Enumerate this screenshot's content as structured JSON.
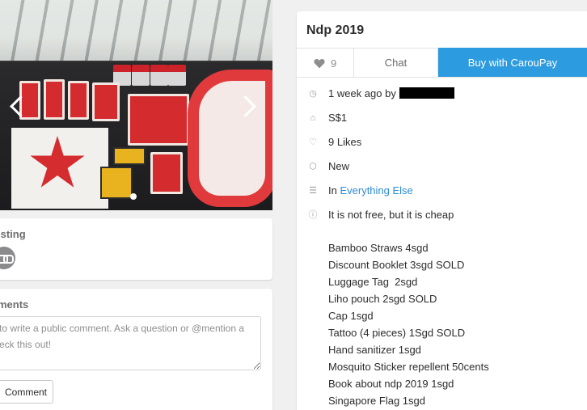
{
  "listing": {
    "title": "Ndp 2019",
    "likes_count": "9",
    "chat_label": "Chat",
    "buy_label": "Buy with CarouPay",
    "posted": "1 week ago by",
    "price": "S$1",
    "likes_text": "9 Likes",
    "condition": "New",
    "category_prefix": "In",
    "category": "Everything Else",
    "tagline": "It is not free, but it is cheap",
    "items": [
      "Bamboo Straws 4sgd",
      "Discount Booklet 3sgd SOLD",
      "Luggage Tag  2sgd",
      "Liho pouch 2sgd SOLD",
      "Cap 1sgd",
      "Tattoo (4 pieces) 1Sgd SOLD",
      "Hand sanitizer 1sgd",
      "Mosquito Sticker repellent 50cents",
      "Book about ndp 2019 1sgd",
      "Singapore Flag 1sgd"
    ]
  },
  "share": {
    "heading": "isting"
  },
  "comments": {
    "heading": "ments",
    "placeholder": "to write a public comment. Ask a question or @mention a\neck this out!",
    "button_label": "Comment"
  },
  "icons": {
    "time": "clock-icon",
    "price": "price-tag-icon",
    "likes": "heart-outline-icon",
    "condition": "box-icon",
    "category": "list-icon",
    "info": "info-icon",
    "share": "link-icon"
  },
  "colors": {
    "accent": "#2d9be0",
    "link": "#2d8cd6"
  }
}
